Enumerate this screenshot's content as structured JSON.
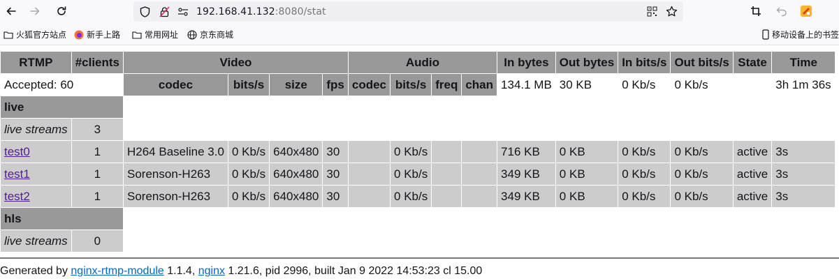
{
  "browser": {
    "url_main": "192.168.41.132",
    "url_dim": ":8080/stat",
    "bookmarks": [
      "火狐官方站点",
      "新手上路",
      "常用网址",
      "京东商城"
    ],
    "mobile_bookmarks": "移动设备上的书签"
  },
  "table": {
    "headers": {
      "rtmp": "RTMP",
      "clients": "#clients",
      "video": "Video",
      "audio": "Audio",
      "in_bytes": "In bytes",
      "out_bytes": "Out bytes",
      "in_bits": "In bits/s",
      "out_bits": "Out bits/s",
      "state": "State",
      "time": "Time"
    },
    "subheaders": {
      "v_codec": "codec",
      "v_bits": "bits/s",
      "v_size": "size",
      "v_fps": "fps",
      "a_codec": "codec",
      "a_bits": "bits/s",
      "a_freq": "freq",
      "a_chan": "chan"
    },
    "summary": {
      "accepted": "Accepted: 60",
      "in_bytes": "134.1 MB",
      "out_bytes": "30 KB",
      "in_bits": "0 Kb/s",
      "out_bits": "0 Kb/s",
      "time": "3h 1m 36s"
    },
    "apps": [
      {
        "name": "live",
        "live_streams_label": "live streams",
        "stream_count": "3",
        "streams": [
          {
            "name": "test0",
            "clients": "1",
            "v_codec": "H264 Baseline 3.0",
            "v_bits": "0 Kb/s",
            "v_size": "640x480",
            "v_fps": "30",
            "a_codec": "",
            "a_bits": "0 Kb/s",
            "a_freq": "",
            "a_chan": "",
            "in_bytes": "716 KB",
            "out_bytes": "0 KB",
            "in_bits": "0 Kb/s",
            "out_bits": "0 Kb/s",
            "state": "active",
            "time": "3s"
          },
          {
            "name": "test1",
            "clients": "1",
            "v_codec": "Sorenson-H263",
            "v_bits": "0 Kb/s",
            "v_size": "640x480",
            "v_fps": "30",
            "a_codec": "",
            "a_bits": "0 Kb/s",
            "a_freq": "",
            "a_chan": "",
            "in_bytes": "349 KB",
            "out_bytes": "0 KB",
            "in_bits": "0 Kb/s",
            "out_bits": "0 Kb/s",
            "state": "active",
            "time": "3s"
          },
          {
            "name": "test2",
            "clients": "1",
            "v_codec": "Sorenson-H263",
            "v_bits": "0 Kb/s",
            "v_size": "640x480",
            "v_fps": "30",
            "a_codec": "",
            "a_bits": "0 Kb/s",
            "a_freq": "",
            "a_chan": "",
            "in_bytes": "349 KB",
            "out_bytes": "0 KB",
            "in_bits": "0 Kb/s",
            "out_bits": "0 Kb/s",
            "state": "active",
            "time": "3s"
          }
        ]
      },
      {
        "name": "hls",
        "live_streams_label": "live streams",
        "stream_count": "0",
        "streams": []
      }
    ]
  },
  "footer": {
    "prefix": "Generated by ",
    "module_link": "nginx-rtmp-module",
    "module_version": " 1.1.4, ",
    "nginx_link": "nginx",
    "rest": " 1.21.6, pid 2996, built Jan 9 2022 14:53:23 cl 15.00"
  },
  "colors": {
    "header": "#999999",
    "row": "#cccccc",
    "link_visited": "#551a8b",
    "link": "#0066cc"
  }
}
